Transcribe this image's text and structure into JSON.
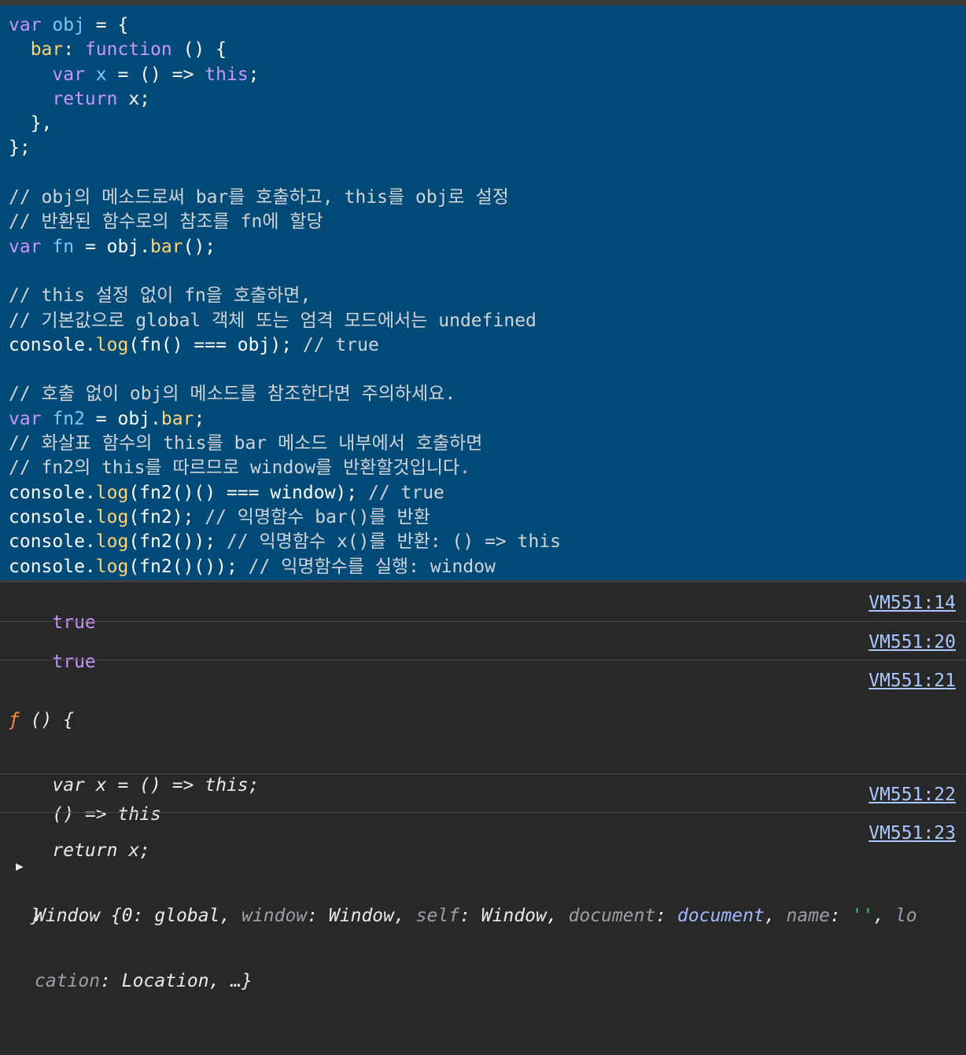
{
  "code": {
    "l1": {
      "kw": "var",
      "name": "obj",
      "rest": " = {"
    },
    "l2": {
      "prop": "bar",
      "colon": ": ",
      "kw": "function",
      "rest": " () {"
    },
    "l3": {
      "kw": "var",
      "name": "x",
      "mid": " = () => ",
      "kw2": "this",
      "end": ";"
    },
    "l4": {
      "kw": "return",
      "rest": " x;"
    },
    "l5": "  },",
    "l6": "};",
    "c1": "// obj의 메소드로써 bar를 호출하고, this를 obj로 설정",
    "c2": "// 반환된 함수로의 참조를 fn에 할당",
    "l9": {
      "kw": "var",
      "name": "fn",
      "mid": " = obj.",
      "prop": "bar",
      "end": "();"
    },
    "c3": "// this 설정 없이 fn을 호출하면,",
    "c4": "// 기본값으로 global 객체 또는 엄격 모드에서는 undefined",
    "l13": {
      "obj": "console.",
      "fn": "log",
      "rest": "(fn() === obj); ",
      "cm": "// true"
    },
    "c5": "// 호출 없이 obj의 메소드를 참조한다면 주의하세요.",
    "l16": {
      "kw": "var",
      "name": "fn2",
      "mid": " = obj.",
      "prop": "bar",
      "end": ";"
    },
    "c6": "// 화살표 함수의 this를 bar 메소드 내부에서 호출하면",
    "c7": "// fn2의 this를 따르므로 window를 반환할것입니다.",
    "l19": {
      "obj": "console.",
      "fn": "log",
      "rest": "(fn2()() === window); ",
      "cm": "// true"
    },
    "l20": {
      "obj": "console.",
      "fn": "log",
      "rest": "(fn2); ",
      "cm": "// 익명함수 bar()를 반환"
    },
    "l21": {
      "obj": "console.",
      "fn": "log",
      "rest": "(fn2()); ",
      "cm": "// 익명함수 x()를 반환: () => this"
    },
    "l22": {
      "obj": "console.",
      "fn": "log",
      "rest": "(fn2()()); ",
      "cm": "// 익명함수를 실행: window"
    }
  },
  "console": {
    "r1": {
      "value": "true",
      "src": "VM551:14"
    },
    "r2": {
      "value": "true",
      "src": "VM551:20"
    },
    "r3": {
      "f": "ƒ",
      "head": " () {",
      "b1": "    var x = () => this;",
      "b2": "    return x;",
      "b3": "  }",
      "src": "VM551:21"
    },
    "r4": {
      "value": "() => this",
      "src": "VM551:22"
    },
    "r5": {
      "src": "VM551:23",
      "arrow": "▶",
      "p1": "Window {0: global, ",
      "k1": "window",
      "v1": ": Window, ",
      "k2": "self",
      "v2": ": Window, ",
      "k3": "document",
      "v3a": ": ",
      "v3": "document",
      "v3b": ", ",
      "k4": "name",
      "v4a": ": ",
      "v4": "''",
      "v4b": ", ",
      "k5a": "lo",
      "k5b": "cation",
      "v5": ": Location, …}"
    }
  }
}
